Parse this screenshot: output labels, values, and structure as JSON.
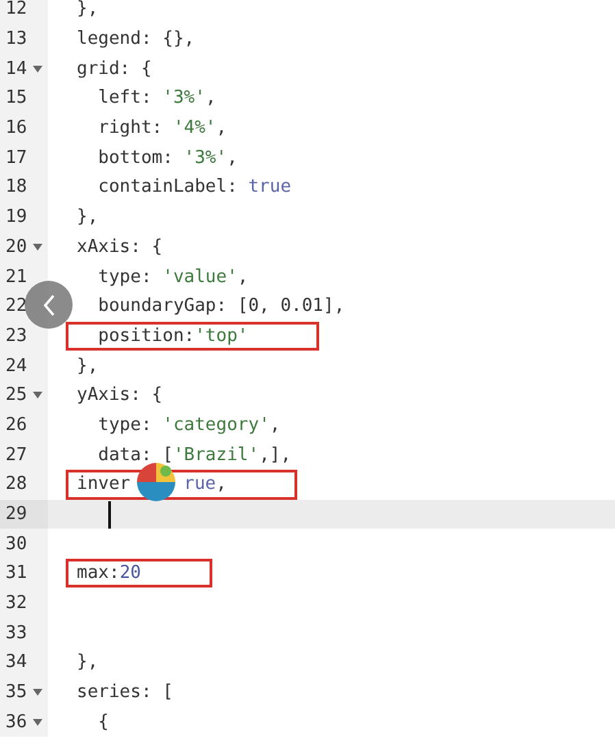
{
  "editor": {
    "lines": [
      {
        "number": "12",
        "foldable": false,
        "highlighted": false,
        "active": false,
        "tokens": [
          {
            "kind": "plain",
            "text": "},"
          }
        ]
      },
      {
        "number": "13",
        "foldable": false,
        "highlighted": false,
        "active": false,
        "tokens": [
          {
            "kind": "plain",
            "text": "legend: {},"
          }
        ]
      },
      {
        "number": "14",
        "foldable": true,
        "highlighted": false,
        "active": false,
        "tokens": [
          {
            "kind": "plain",
            "text": "grid: {"
          }
        ]
      },
      {
        "number": "15",
        "foldable": false,
        "highlighted": false,
        "active": false,
        "tokens": [
          {
            "kind": "plain",
            "text": "  left: "
          },
          {
            "kind": "string",
            "text": "'3%'"
          },
          {
            "kind": "plain",
            "text": ","
          }
        ]
      },
      {
        "number": "16",
        "foldable": false,
        "highlighted": false,
        "active": false,
        "tokens": [
          {
            "kind": "plain",
            "text": "  right: "
          },
          {
            "kind": "string",
            "text": "'4%'"
          },
          {
            "kind": "plain",
            "text": ","
          }
        ]
      },
      {
        "number": "17",
        "foldable": false,
        "highlighted": false,
        "active": false,
        "tokens": [
          {
            "kind": "plain",
            "text": "  bottom: "
          },
          {
            "kind": "string",
            "text": "'3%'"
          },
          {
            "kind": "plain",
            "text": ","
          }
        ]
      },
      {
        "number": "18",
        "foldable": false,
        "highlighted": false,
        "active": false,
        "tokens": [
          {
            "kind": "plain",
            "text": "  containLabel: "
          },
          {
            "kind": "keyword",
            "text": "true"
          }
        ]
      },
      {
        "number": "19",
        "foldable": false,
        "highlighted": false,
        "active": false,
        "tokens": [
          {
            "kind": "plain",
            "text": "},"
          }
        ]
      },
      {
        "number": "20",
        "foldable": true,
        "highlighted": false,
        "active": false,
        "tokens": [
          {
            "kind": "plain",
            "text": "xAxis: {"
          }
        ]
      },
      {
        "number": "21",
        "foldable": false,
        "highlighted": false,
        "active": false,
        "tokens": [
          {
            "kind": "plain",
            "text": "  type: "
          },
          {
            "kind": "string",
            "text": "'value'"
          },
          {
            "kind": "plain",
            "text": ","
          }
        ]
      },
      {
        "number": "22",
        "foldable": false,
        "highlighted": false,
        "active": false,
        "tokens": [
          {
            "kind": "plain",
            "text": "  boundaryGap: [0, 0.01],"
          }
        ]
      },
      {
        "number": "23",
        "foldable": false,
        "highlighted": true,
        "active": false,
        "tokens": [
          {
            "kind": "plain",
            "text": "  position:"
          },
          {
            "kind": "string",
            "text": "'top'"
          }
        ]
      },
      {
        "number": "24",
        "foldable": false,
        "highlighted": false,
        "active": false,
        "tokens": [
          {
            "kind": "plain",
            "text": "},"
          }
        ]
      },
      {
        "number": "25",
        "foldable": true,
        "highlighted": false,
        "active": false,
        "tokens": [
          {
            "kind": "plain",
            "text": "yAxis: {"
          }
        ]
      },
      {
        "number": "26",
        "foldable": false,
        "highlighted": false,
        "active": false,
        "tokens": [
          {
            "kind": "plain",
            "text": "  type: "
          },
          {
            "kind": "string",
            "text": "'category'"
          },
          {
            "kind": "plain",
            "text": ","
          }
        ]
      },
      {
        "number": "27",
        "foldable": false,
        "highlighted": false,
        "active": false,
        "tokens": [
          {
            "kind": "plain",
            "text": "  data: ["
          },
          {
            "kind": "string",
            "text": "'Brazil'"
          },
          {
            "kind": "plain",
            "text": ",],"
          }
        ]
      },
      {
        "number": "28",
        "foldable": false,
        "highlighted": true,
        "active": false,
        "tokens": [
          {
            "kind": "plain",
            "text": "inver"
          },
          {
            "kind": "logo"
          },
          {
            "kind": "keyword",
            "text": "rue"
          },
          {
            "kind": "plain",
            "text": ","
          }
        ]
      },
      {
        "number": "29",
        "foldable": false,
        "highlighted": false,
        "active": true
      },
      {
        "number": "30",
        "foldable": false,
        "highlighted": false,
        "active": false
      },
      {
        "number": "31",
        "foldable": false,
        "highlighted": true,
        "active": false,
        "tokens": [
          {
            "kind": "plain",
            "text": "max:"
          },
          {
            "kind": "number",
            "text": "20"
          }
        ]
      },
      {
        "number": "32",
        "foldable": false,
        "highlighted": false,
        "active": false
      },
      {
        "number": "33",
        "foldable": false,
        "highlighted": false,
        "active": false
      },
      {
        "number": "34",
        "foldable": false,
        "highlighted": false,
        "active": false,
        "tokens": [
          {
            "kind": "plain",
            "text": "},"
          }
        ]
      },
      {
        "number": "35",
        "foldable": true,
        "highlighted": false,
        "active": false,
        "tokens": [
          {
            "kind": "plain",
            "text": "series: ["
          }
        ]
      },
      {
        "number": "36",
        "foldable": true,
        "highlighted": false,
        "active": false,
        "tokens": [
          {
            "kind": "plain",
            "text": "  {"
          }
        ]
      }
    ]
  }
}
